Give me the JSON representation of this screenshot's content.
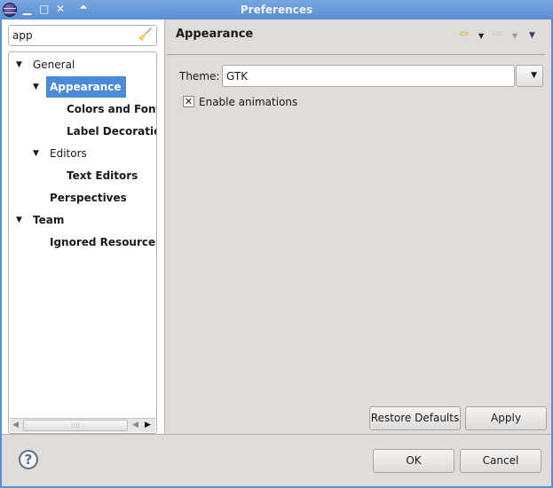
{
  "window": {
    "title": "Preferences"
  },
  "search": {
    "value": "app"
  },
  "tree": [
    {
      "label": "General",
      "level": 0,
      "twisty": "expanded",
      "bold": false
    },
    {
      "label": "Appearance",
      "level": 1,
      "twisty": "expanded",
      "bold": true,
      "selected": true
    },
    {
      "label": "Colors and Fonts",
      "level": 2,
      "bold": true
    },
    {
      "label": "Label Decorations",
      "level": 2,
      "bold": true
    },
    {
      "label": "Editors",
      "level": 1,
      "twisty": "expanded",
      "bold": false
    },
    {
      "label": "Text Editors",
      "level": 2,
      "bold": true
    },
    {
      "label": "Perspectives",
      "level": 1,
      "bold": true
    },
    {
      "label": "Team",
      "level": 0,
      "twisty": "expanded",
      "bold": true
    },
    {
      "label": "Ignored Resources",
      "level": 1,
      "bold": true
    }
  ],
  "page": {
    "title": "Appearance",
    "theme_label": "Theme:",
    "theme_value": "GTK",
    "enable_animations": {
      "label": "Enable animations",
      "checked": true
    }
  },
  "buttons": {
    "restore": "Restore Defaults",
    "apply": "Apply",
    "ok": "OK",
    "cancel": "Cancel"
  },
  "colors": {
    "selection": "#4a8ad8",
    "titlebar": "#5a8ed3"
  }
}
